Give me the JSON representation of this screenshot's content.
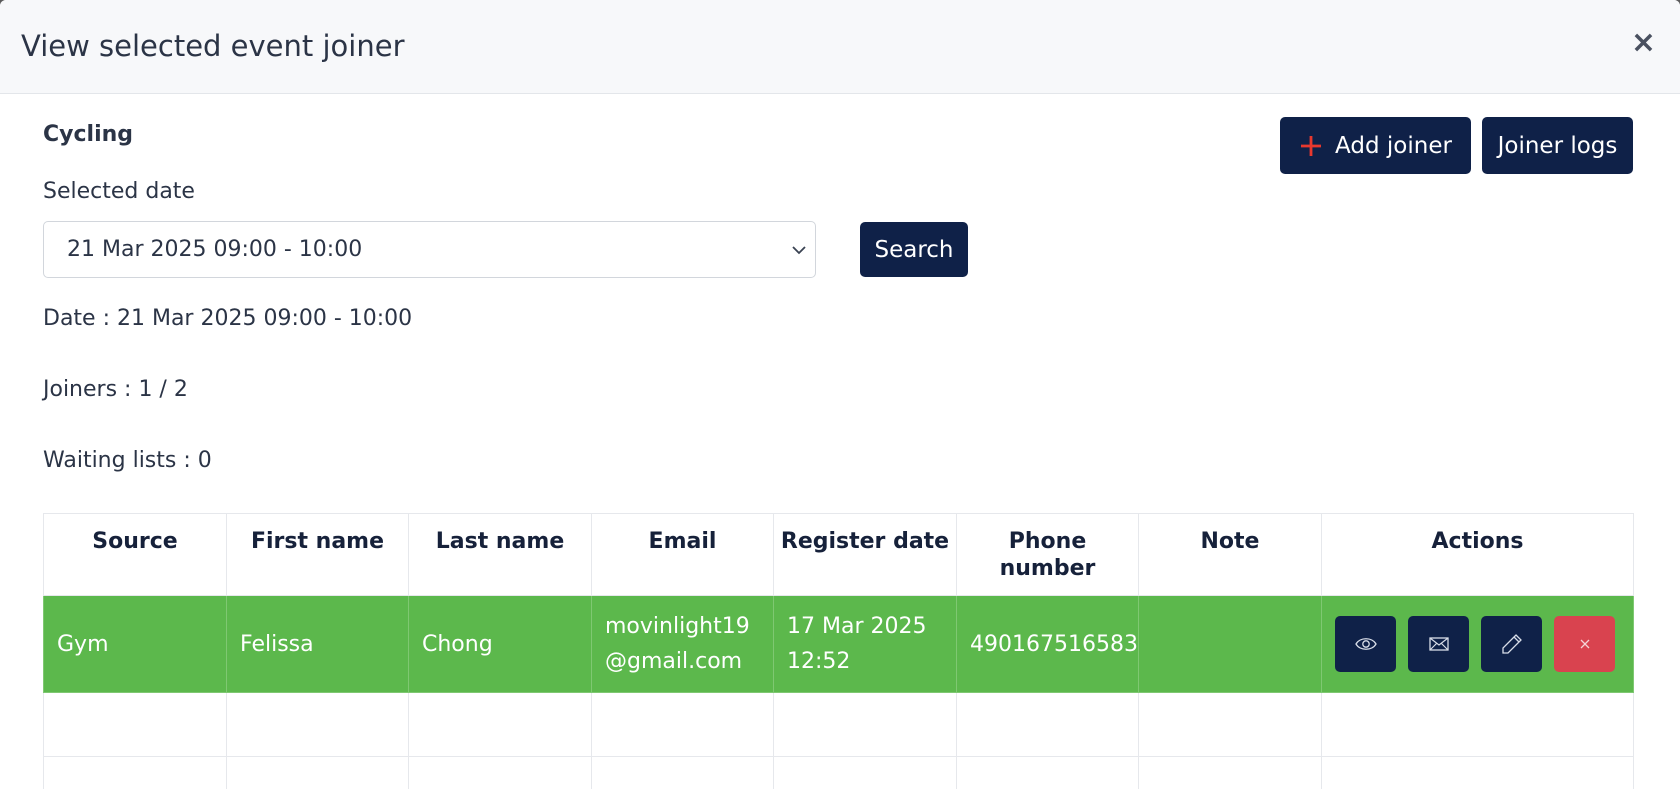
{
  "modal": {
    "title": "View selected event joiner",
    "close_label": "×"
  },
  "event": {
    "name": "Cycling",
    "selected_date_label": "Selected date",
    "selected_date_value": "21 Mar 2025 09:00 - 10:00"
  },
  "buttons": {
    "search": "Search",
    "add_joiner": "Add joiner",
    "joiner_logs": "Joiner logs"
  },
  "info": {
    "date": "Date : 21 Mar 2025 09:00 - 10:00",
    "joiners": "Joiners : 1 / 2",
    "waiting": "Waiting lists : 0"
  },
  "table": {
    "headers": [
      "Source",
      "First name",
      "Last name",
      "Email",
      "Register date",
      "Phone number",
      "Note",
      "Actions"
    ],
    "rows": [
      {
        "source": "Gym",
        "first_name": "Felissa",
        "last_name": "Chong",
        "email": "movinlight19@gmail.com",
        "register_date": "17 Mar 2025 12:52",
        "phone": "490167516583",
        "note": ""
      }
    ]
  },
  "icons": {
    "action_icons": [
      "eye-icon",
      "mail-icon",
      "pencil-icon",
      "close-icon"
    ],
    "add_icon": "plus-icon",
    "select_icon": "chevron-down-icon"
  },
  "colors": {
    "primary": "#0f2148",
    "row_highlight": "#5cb84c",
    "danger": "#d9434f",
    "plus": "#e8382e"
  }
}
